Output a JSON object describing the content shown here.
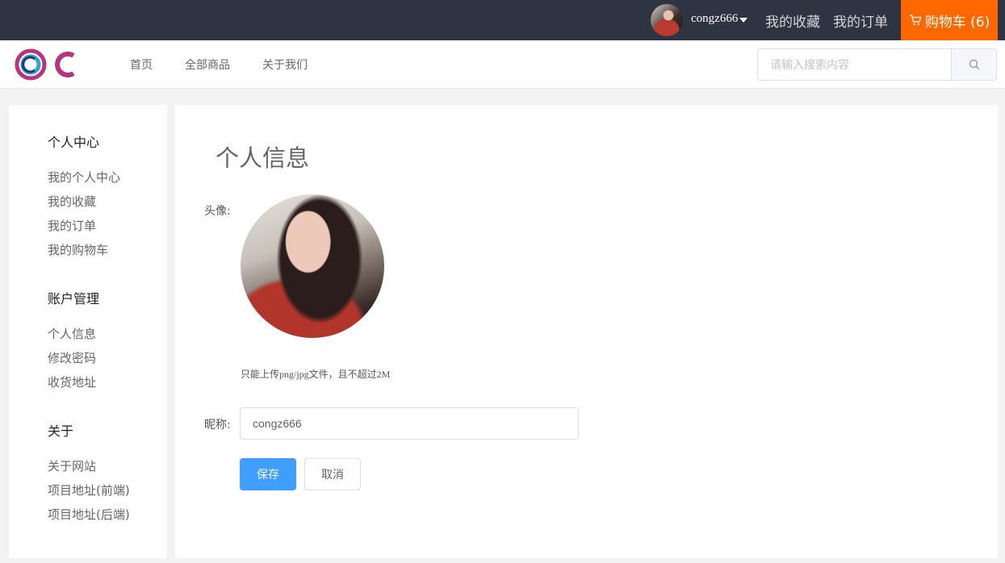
{
  "topbar": {
    "username": "congz666",
    "favorites_label": "我的收藏",
    "orders_label": "我的订单",
    "cart_label": "购物车 (6)",
    "cart_color": "#ff6700",
    "background": "#2f3443"
  },
  "navbar": {
    "links": [
      {
        "label": "首页"
      },
      {
        "label": "全部商品"
      },
      {
        "label": "关于我们"
      }
    ],
    "search": {
      "placeholder": "请输入搜索内容"
    }
  },
  "sidebar": {
    "sections": [
      {
        "title": "个人中心",
        "items": [
          "我的个人中心",
          "我的收藏",
          "我的订单",
          "我的购物车"
        ]
      },
      {
        "title": "账户管理",
        "items": [
          "个人信息",
          "修改密码",
          "收货地址"
        ]
      },
      {
        "title": "关于",
        "items": [
          "关于网站",
          "项目地址(前端)",
          "项目地址(后端)"
        ]
      }
    ]
  },
  "main": {
    "title": "个人信息",
    "avatar_label": "头像:",
    "upload_tip": "只能上传png/jpg文件，且不超过2M",
    "nickname_label": "昵称:",
    "nickname_value": "congz666",
    "save_label": "保存",
    "cancel_label": "取消",
    "primary_color": "#409eff"
  }
}
